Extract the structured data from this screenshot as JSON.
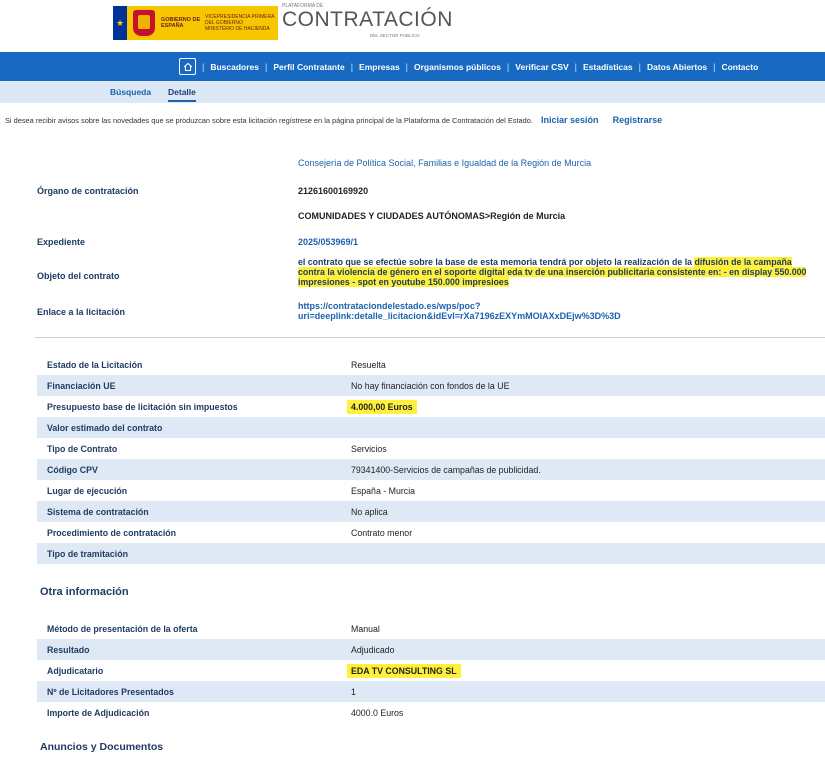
{
  "header": {
    "gov_top": "VICEPRESIDENCIA PRIMERA DEL GOBIERNO",
    "gov_name": "GOBIERNO DE ESPAÑA",
    "ministry": "MINISTERIO DE HACIENDA",
    "plataforma": "PLATAFORMA DE",
    "title": "CONTRATACIÓN",
    "subtitle": "DEL SECTOR PÚBLICO"
  },
  "nav": {
    "items": [
      "Buscadores",
      "Perfil Contratante",
      "Empresas",
      "Organismos públicos",
      "Verificar CSV",
      "Estadísticas",
      "Datos Abiertos",
      "Contacto"
    ]
  },
  "tabs": {
    "busqueda": "Búsqueda",
    "detalle": "Detalle"
  },
  "notice": {
    "text": "Si desea recibir avisos sobre las novedades que se produzcan sobre esta licitación regístrese en la página principal de la Plataforma de Contratación del Estado.",
    "login": "Iniciar sesión",
    "register": "Registrarse"
  },
  "detail": {
    "consejeria": "Consejería de Política Social, Familias e Igualdad de la Región de Murcia",
    "organo_label": "Órgano de contratación",
    "organo_id": "21261600169920",
    "organo_tipo": "COMUNIDADES Y CIUDADES AUTÓNOMAS>Región de Murcia",
    "expediente_label": "Expediente",
    "expediente": "2025/053969/1",
    "objeto_label": "Objeto del contrato",
    "objeto_plain": "el contrato que se efectúe sobre la base de esta memoria tendrá por objeto la realización de la ",
    "objeto_hl": "difusión de la campaña contra la violencia de género en el soporte digital eda tv de una inserción publicitaria consistente en: - en display 550.000 impresiones - spot en youtube 150.000 impresioes",
    "enlace_label": "Enlace a la licitación",
    "enlace_1": "https://contrataciondelestado.es/wps/poc?",
    "enlace_2": "uri=deeplink:detalle_licitacion&idEvl=rXa7196zEXYmMOIAXxDEjw%3D%3D"
  },
  "table1": [
    {
      "k": "Estado de la Licitación",
      "v": "Resuelta"
    },
    {
      "k": "Financiación UE",
      "v": "No hay financiación con fondos de la UE"
    },
    {
      "k": "Presupuesto base de licitación sin impuestos",
      "v": "4.000,00 Euros"
    },
    {
      "k": "Valor estimado del contrato",
      "v": ""
    },
    {
      "k": "Tipo de Contrato",
      "v": "Servicios"
    },
    {
      "k": "Código CPV",
      "v": "79341400-Servicios de campañas de publicidad."
    },
    {
      "k": "Lugar de ejecución",
      "v": "España - Murcia"
    },
    {
      "k": "Sistema de contratación",
      "v": "No aplica"
    },
    {
      "k": "Procedimiento de contratación",
      "v": "Contrato menor"
    },
    {
      "k": "Tipo de tramitación",
      "v": ""
    }
  ],
  "otra_title": "Otra información",
  "table2": [
    {
      "k": "Método de presentación de la oferta",
      "v": "Manual"
    },
    {
      "k": "Resultado",
      "v": "Adjudicado"
    },
    {
      "k": "Adjudicatario",
      "v": "EDA TV CONSULTING SL"
    },
    {
      "k": "Nº de Licitadores Presentados",
      "v": "1"
    },
    {
      "k": "Importe de Adjudicación",
      "v": "4000.0 Euros"
    }
  ],
  "anuncios_title": "Anuncios y Documentos",
  "colors": {
    "nav": "#1769c1",
    "highlight": "#fff13b",
    "label": "#1f3b63",
    "link": "#1b62ad"
  }
}
